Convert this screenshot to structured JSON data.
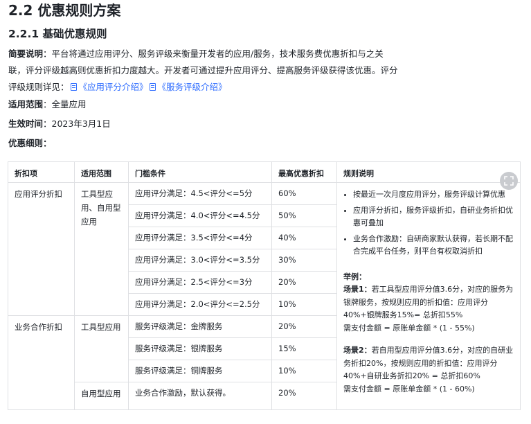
{
  "title": "2.2 优惠规则方案",
  "subtitle": "2.2.1 基础优惠规则",
  "summary": {
    "label": "简要说明",
    "line1": "：平台将通过应用评分、服务评级来衡量开发者的应用/服务，技术服务费优惠折扣与之关",
    "line2": "联，评分评级越高则优惠折扣力度越大。开发者可通过提升应用评分、提高服务评级获得该优惠。评分",
    "line3": "评级规则详见：",
    "link1": "《应用评分介绍》",
    "link2": "《服务评级介绍》"
  },
  "scope": {
    "label": "适用范围",
    "value": "：全量应用"
  },
  "effective": {
    "label": "生效时间",
    "value": "：2023年3月1日"
  },
  "details_label": "优惠细则：",
  "table": {
    "headers": [
      "折扣项",
      "适用范围",
      "门槛条件",
      "最高优惠折扣",
      "规则说明"
    ],
    "group1": {
      "item": "应用评分折扣",
      "scope": "工具型应用、自用型应用",
      "rows": [
        {
          "cond": "应用评分满足：4.5<评分<=5分",
          "disc": "60%"
        },
        {
          "cond": "应用评分满足：4.0<评分<=4.5分",
          "disc": "50%"
        },
        {
          "cond": "应用评分满足：3.5<评分<=4分",
          "disc": "40%"
        },
        {
          "cond": "应用评分满足：3.0<评分<=3.5分",
          "disc": "30%"
        },
        {
          "cond": "应用评分满足：2.5<评分<=3分",
          "disc": "20%"
        },
        {
          "cond": "应用评分满足：2.0<评分<=2.5分",
          "disc": "10%"
        }
      ]
    },
    "group2": {
      "item": "业务合作折扣",
      "scope_tool": "工具型应用",
      "rows_tool": [
        {
          "cond": "服务评级满足：金牌服务",
          "disc": "20%"
        },
        {
          "cond": "服务评级满足：银牌服务",
          "disc": "15%"
        },
        {
          "cond": "服务评级满足：铜牌服务",
          "disc": "10%"
        }
      ],
      "scope_self": "自用型应用",
      "row_self": {
        "cond": "业务合作激励，默认获得。",
        "disc": "20%"
      }
    },
    "rules": {
      "bullets": [
        "按最近一次月度应用评分，服务评级计算优惠",
        "应用评分折扣，服务评级折扣，自研业务折扣优惠可叠加",
        "业务合作激励：自研商家默认获得，若长期不配合完成平台任务，则平台有权取消折扣"
      ],
      "example_label": "举例：",
      "s1_label": "场景1：",
      "s1_text": "若工具型应用评分值3.6分，对应的服务为银牌服务，按规则应用的折扣值：应用评分40%+银牌服务15%= 总折扣55%",
      "s1_pay": "需支付金额 = 原账单金额 * (1 - 55%)",
      "s2_label": "场景2：",
      "s2_text": "若自用型应用评分值3.6分，对应的自研业务折扣20%，按规则应用的折扣值：应用评分40%+自研业务折扣20% = 总折扣60%",
      "s2_pay": "需支付金额 = 原账单金额 * (1 - 60%)"
    }
  }
}
